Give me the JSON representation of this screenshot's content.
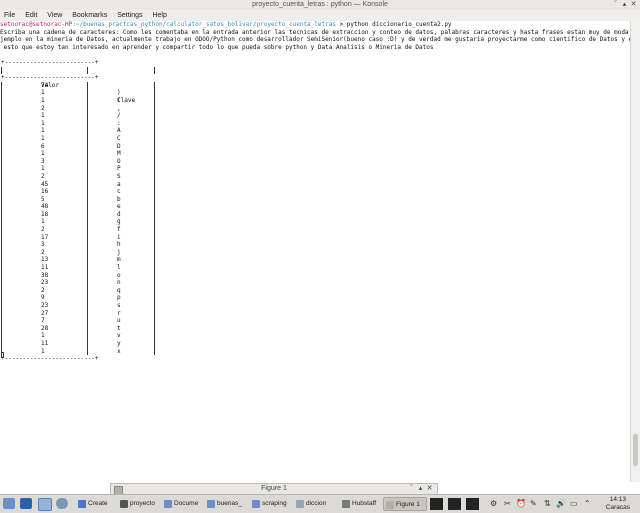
{
  "window": {
    "title": "proyecto_cuenta_letras : python — Konsole",
    "controls": [
      "ˇ",
      "▴",
      "✕"
    ]
  },
  "menu": [
    "File",
    "Edit",
    "View",
    "Bookmarks",
    "Settings",
    "Help"
  ],
  "terminal": {
    "prompt_user": "setnorac@setnorac-HP",
    "prompt_path": ":~/buenas_practcas_python/calculator_satos_bolivar/proyecto_cuenta_letras",
    "prompt_cmd": " > python diccionario_cuenta2.py",
    "intro_lines": [
      "Escriba una cadena de caracteres: Como les comentaba en la entrada anterior las tecnicas de extraccion y conteo de datos, palabras caracteres y hasta frases estan muy de moda por e",
      "jemplo en la mineria de Datos, actualmente trabajo en ODOO/Python como desarrollador SemiSenior(bueno caso :D) y de verdad me gustaria proyectarme como cientifico de Datos y es por",
      " esto que estoy tan interesado en aprender y compartir todo lo que pueda sobre python y Data Analisis o Mineria de Datos"
    ],
    "separator": "+-------------------------+",
    "header_valor": "Valor",
    "header_clave": "Clave",
    "rows": [
      {
        "valor": "74",
        "clave": ""
      },
      {
        "valor": "1",
        "clave": ")"
      },
      {
        "valor": "1",
        "clave": "("
      },
      {
        "valor": "2",
        "clave": ","
      },
      {
        "valor": "1",
        "clave": "/"
      },
      {
        "valor": "1",
        "clave": ":"
      },
      {
        "valor": "1",
        "clave": "A"
      },
      {
        "valor": "1",
        "clave": "C"
      },
      {
        "valor": "6",
        "clave": "D"
      },
      {
        "valor": "1",
        "clave": "M"
      },
      {
        "valor": "3",
        "clave": "O"
      },
      {
        "valor": "1",
        "clave": "P"
      },
      {
        "valor": "2",
        "clave": "S"
      },
      {
        "valor": "45",
        "clave": "a"
      },
      {
        "valor": "16",
        "clave": "c"
      },
      {
        "valor": "5",
        "clave": "b"
      },
      {
        "valor": "48",
        "clave": "e"
      },
      {
        "valor": "18",
        "clave": "d"
      },
      {
        "valor": "1",
        "clave": "g"
      },
      {
        "valor": "2",
        "clave": "f"
      },
      {
        "valor": "17",
        "clave": "i"
      },
      {
        "valor": "3",
        "clave": "h"
      },
      {
        "valor": "2",
        "clave": "j"
      },
      {
        "valor": "13",
        "clave": "m"
      },
      {
        "valor": "11",
        "clave": "l"
      },
      {
        "valor": "38",
        "clave": "o"
      },
      {
        "valor": "23",
        "clave": "n"
      },
      {
        "valor": "2",
        "clave": "q"
      },
      {
        "valor": "9",
        "clave": "p"
      },
      {
        "valor": "23",
        "clave": "s"
      },
      {
        "valor": "27",
        "clave": "r"
      },
      {
        "valor": "7",
        "clave": "u"
      },
      {
        "valor": "28",
        "clave": "t"
      },
      {
        "valor": "1",
        "clave": "v"
      },
      {
        "valor": "11",
        "clave": "y"
      },
      {
        "valor": "1",
        "clave": "x"
      }
    ]
  },
  "figure_window": {
    "title": "Figure 1",
    "controls": [
      "ˇ",
      "▴",
      "✕"
    ]
  },
  "taskbar": {
    "tasks": [
      {
        "label": "Create",
        "color": "#4a76c9",
        "active": false
      },
      {
        "label": "proyecto",
        "color": "#555555",
        "active": false
      },
      {
        "label": "Docume",
        "color": "#6b8cc4",
        "active": false
      },
      {
        "label": "buenas_",
        "color": "#6b8cc4",
        "active": false
      },
      {
        "label": "scraping",
        "color": "#6b8cc4",
        "active": false
      },
      {
        "label": "diccion",
        "color": "#9aa6b8",
        "active": false
      },
      {
        "label": "Hubstaff",
        "color": "#7a7a7a",
        "active": false
      },
      {
        "label": "Figure 1",
        "color": "#b7b0a5",
        "active": true
      }
    ],
    "clock_time": "14:13",
    "clock_city": "Caracas"
  }
}
